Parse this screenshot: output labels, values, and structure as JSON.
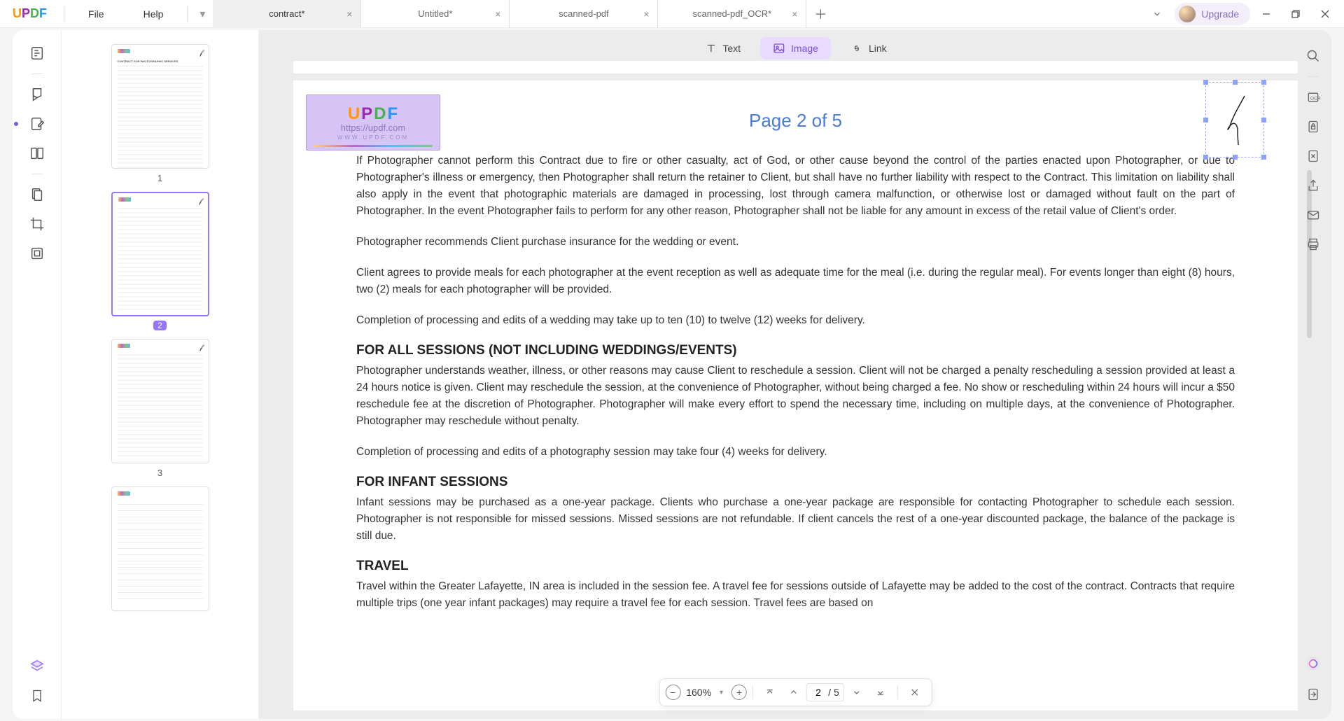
{
  "menu": {
    "file": "File",
    "help": "Help"
  },
  "tabs": [
    {
      "label": "contract*",
      "active": true
    },
    {
      "label": "Untitled*",
      "active": false
    },
    {
      "label": "scanned-pdf",
      "active": false
    },
    {
      "label": "scanned-pdf_OCR*",
      "active": false
    }
  ],
  "upgrade": "Upgrade",
  "top_tools": {
    "text": "Text",
    "image": "Image",
    "link": "Link"
  },
  "thumbs": [
    "1",
    "2",
    "3"
  ],
  "watermark": {
    "url": "https://updf.com",
    "sub": "WWW.UPDF.COM"
  },
  "page": {
    "title": "Page 2 of 5",
    "para1": "If Photographer cannot perform this Contract due to fire or other casualty, act of God, or other cause beyond the control of the parties enacted upon Photographer, or due to Photographer's illness or emergency, then Photographer shall return the retainer to Client, but shall have no further liability with respect to the Contract. This limitation on liability shall also apply in the event that photographic materials are damaged in processing, lost through camera malfunction, or otherwise lost or damaged without fault on the part of Photographer. In the event Photographer fails to perform for any other reason, Photographer shall not be liable for any amount in excess of the retail value of Client's order.",
    "para2": "Photographer recommends Client purchase insurance for the wedding or event.",
    "para3": "Client agrees to provide meals for each photographer at the event reception as well as adequate time for the meal (i.e. during the regular meal). For events longer than eight (8) hours, two (2) meals for each photographer will be provided.",
    "para4": "Completion of processing and edits of a wedding may take up to ten (10) to twelve (12) weeks for delivery.",
    "h1": "FOR ALL SESSIONS (NOT INCLUDING WEDDINGS/EVENTS)",
    "para5": "Photographer understands weather, illness, or other reasons may cause Client to reschedule a session. Client will not be charged a penalty rescheduling a session provided at least a 24 hours notice is given. Client may reschedule the session, at the convenience of Photographer, without being charged a fee. No show or rescheduling within 24 hours will incur a $50 reschedule fee at the discretion of Photographer. Photographer will make every effort to spend the necessary time, including on multiple days, at the convenience of Photographer. Photographer may reschedule without penalty.",
    "para6": "Completion of processing and edits of a photography session may take four (4) weeks for delivery.",
    "h2": "FOR INFANT SESSIONS",
    "para7": "Infant sessions may be purchased as a one-year package. Clients who purchase a one-year package are responsible for contacting Photographer to schedule each session. Photographer is not responsible for missed sessions. Missed sessions are not refundable. If client cancels the rest of a one-year discounted package, the balance of the package is still due.",
    "h3": "TRAVEL",
    "para8": "Travel within the Greater Lafayette, IN area is included in the session fee. A travel fee for sessions outside of Lafayette may be added to the cost of the contract. Contracts that require multiple trips (one year infant packages) may require a travel fee for each session. Travel fees are based on"
  },
  "bottom": {
    "zoom": "160%",
    "current": "2",
    "sep": "/",
    "total": "5"
  }
}
